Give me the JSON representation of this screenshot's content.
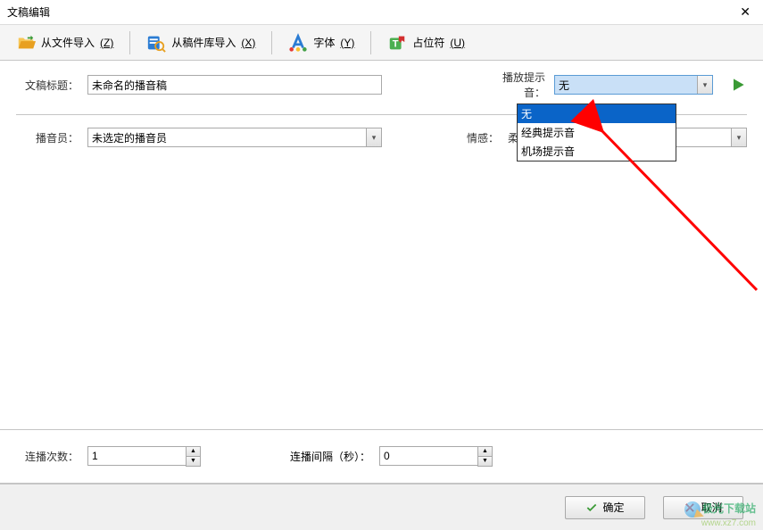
{
  "title": "文稿编辑",
  "toolbar": {
    "import_file": "从文件导入",
    "import_file_accel": "(Z)",
    "import_lib": "从稿件库导入",
    "import_lib_accel": "(X)",
    "font": "字体",
    "font_accel": "(Y)",
    "placeholder": "占位符",
    "placeholder_accel": "(U)"
  },
  "fields": {
    "title_label": "文稿标题：",
    "title_value": "未命名的播音稿",
    "sound_label": "播放提示音：",
    "sound_value": "无",
    "announcer_label": "播音员：",
    "announcer_value": "未选定的播音员",
    "emotion_label": "情感：",
    "emotion_value": "柔和"
  },
  "dropdown": {
    "options": [
      "无",
      "经典提示音",
      "机场提示音"
    ],
    "selected_index": 0
  },
  "bottom": {
    "repeat_label": "连播次数：",
    "repeat_value": "1",
    "interval_label": "连播间隔（秒）：",
    "interval_value": "0"
  },
  "footer": {
    "ok": "确定",
    "cancel": "取消"
  },
  "watermark": {
    "line1": "极光下载站",
    "line2": "www.xz7.com"
  }
}
